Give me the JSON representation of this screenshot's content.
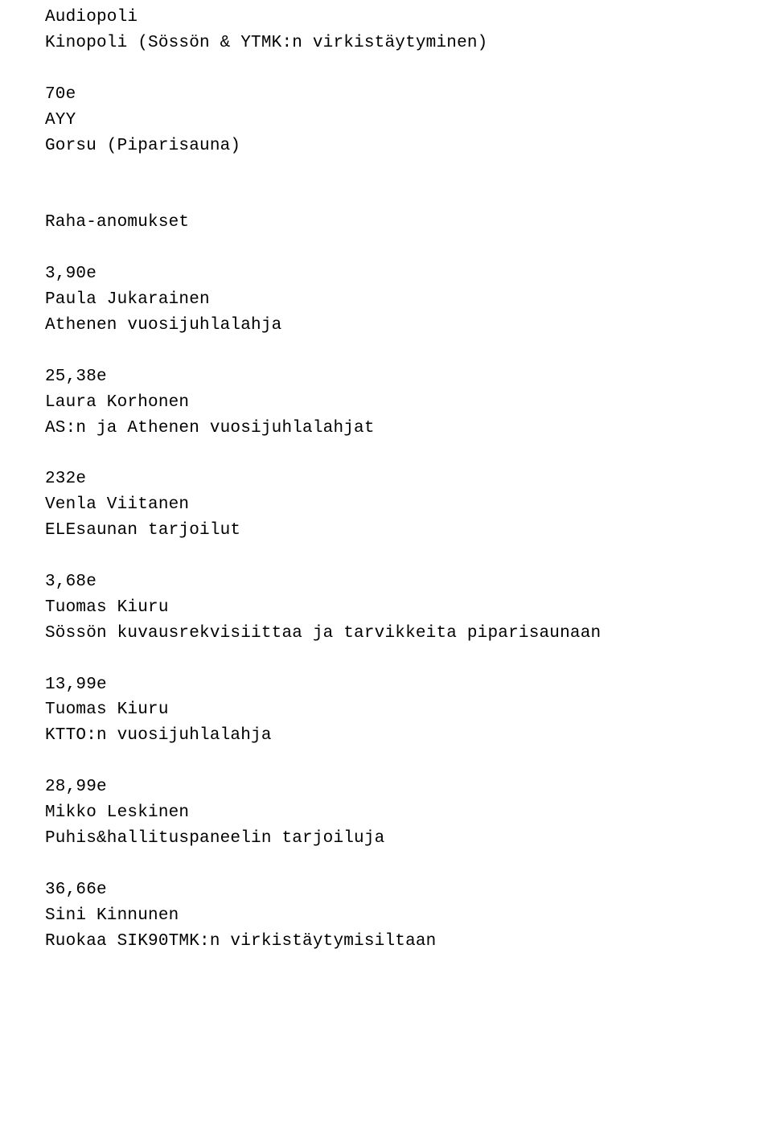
{
  "lines": [
    "Audiopoli",
    "Kinopoli (Sössön & YTMK:n virkistäytyminen)",
    "",
    "70e",
    "AYY",
    "Gorsu (Piparisauna)",
    "",
    "",
    "Raha-anomukset",
    "",
    "3,90e",
    "Paula Jukarainen",
    "Athenen vuosijuhlalahja",
    "",
    "25,38e",
    "Laura Korhonen",
    "AS:n ja Athenen vuosijuhlalahjat",
    "",
    "232e",
    "Venla Viitanen",
    "ELEsaunan tarjoilut",
    "",
    "3,68e",
    "Tuomas Kiuru",
    "Sössön kuvausrekvisiittaa ja tarvikkeita piparisaunaan",
    "",
    "13,99e",
    "Tuomas Kiuru",
    "KTTO:n vuosijuhlalahja",
    "",
    "28,99e",
    "Mikko Leskinen",
    "Puhis&hallituspaneelin tarjoiluja",
    "",
    "36,66e",
    "Sini Kinnunen",
    "Ruokaa SIK90TMK:n virkistäytymisiltaan"
  ]
}
